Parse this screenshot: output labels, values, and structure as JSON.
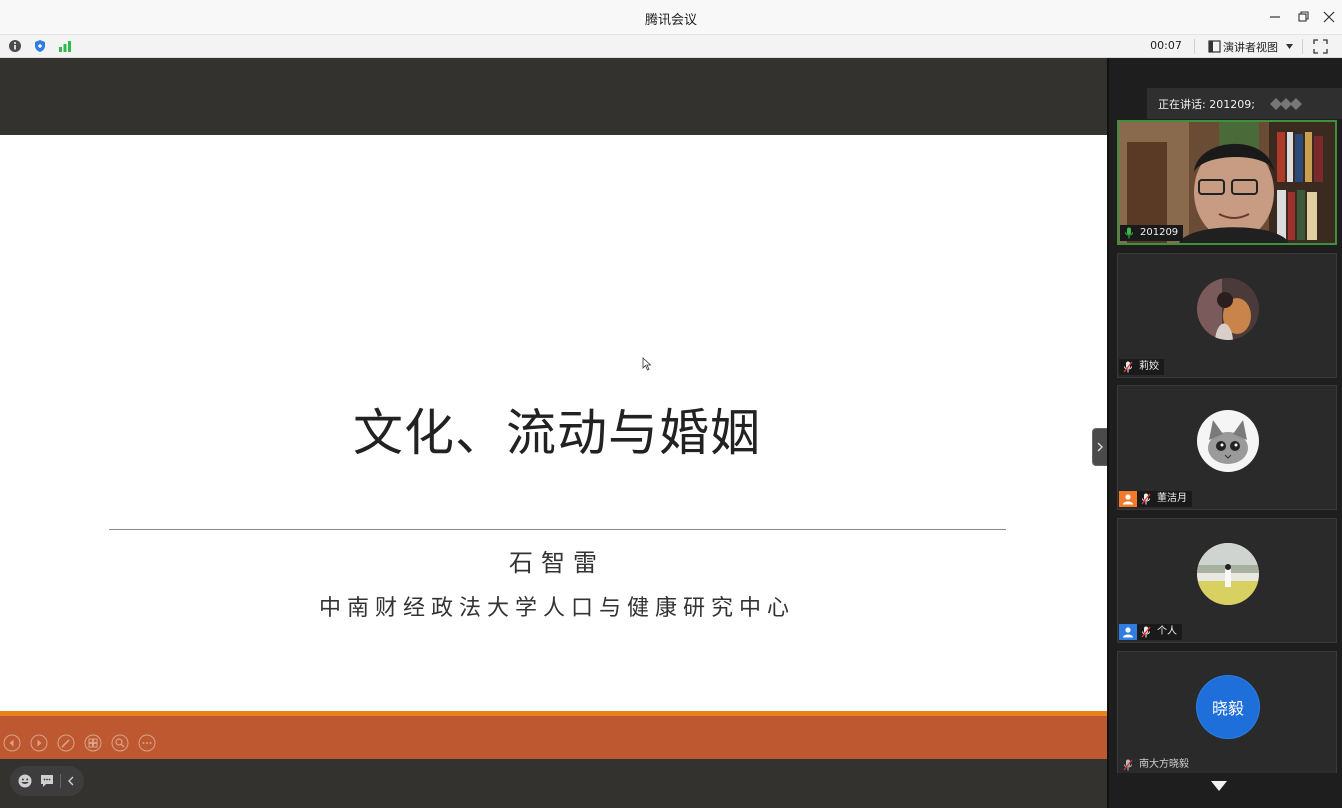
{
  "window": {
    "title": "腾讯会议"
  },
  "toolbar": {
    "timer": "00:07",
    "view_label": "演讲者视图"
  },
  "slide": {
    "title": "文化、流动与婚姻",
    "author": "石智雷",
    "affiliation": "中南财经政法大学人口与健康研究中心"
  },
  "panel": {
    "speaking_label": "正在讲话: 201209;",
    "participants": [
      {
        "name": "201209",
        "mic": "on",
        "role": "video"
      },
      {
        "name": "莉姣",
        "mic": "muted",
        "role": "avatar-photo"
      },
      {
        "name": "董洁月",
        "mic": "muted",
        "role": "avatar-cat",
        "user_badge_color": "#f07a2a"
      },
      {
        "name": "个人",
        "mic": "muted",
        "role": "avatar-field",
        "user_badge_color": "#2f7de1"
      },
      {
        "name": "南大方晓毅",
        "mic": "muted",
        "role": "avatar-text",
        "avatar_text": "晓毅",
        "avatar_color": "#1e6fd9"
      }
    ]
  },
  "colors": {
    "slide_accent_orange": "#e8801c",
    "slide_bar": "#bd5830",
    "active_speaker_border": "#3f8f3f"
  }
}
